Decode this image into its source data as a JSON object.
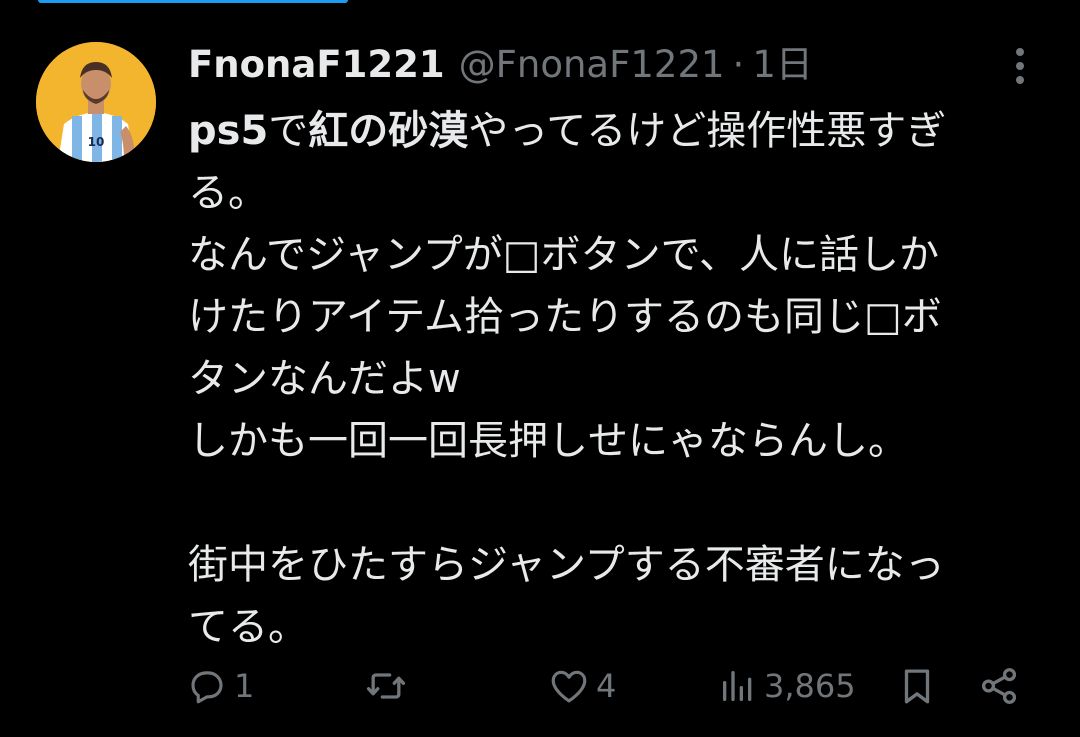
{
  "user": {
    "display_name": "FnonaF1221",
    "handle": "@FnonaF1221",
    "separator": "·",
    "time": "1日"
  },
  "tweet": {
    "line1_plain1": "ps5",
    "line1_bold1": "",
    "line1_a": "で",
    "line1_b": "紅の砂漠",
    "line1_c": "やってるけど操作性悪すぎ",
    "line2": "る。",
    "line3": "なんでジャンプが□ボタンで、人に話しか",
    "line4": "けたりアイテム拾ったりするのも同じ□ボ",
    "line5": "タンなんだよw",
    "line6": "しかも一回一回長押しせにゃならんし。",
    "line7": "街中をひたすらジャンプする不審者になっ",
    "line8": "てる。"
  },
  "actions": {
    "reply_count": "1",
    "retweet_count": "",
    "like_count": "4",
    "views_count": "3,865"
  },
  "colors": {
    "background": "#000000",
    "text": "#e7e9ea",
    "muted": "#71767b",
    "accent": "#1d9bf0"
  },
  "icons": [
    "more-icon",
    "reply-icon",
    "retweet-icon",
    "like-icon",
    "views-icon",
    "bookmark-icon",
    "share-icon"
  ]
}
